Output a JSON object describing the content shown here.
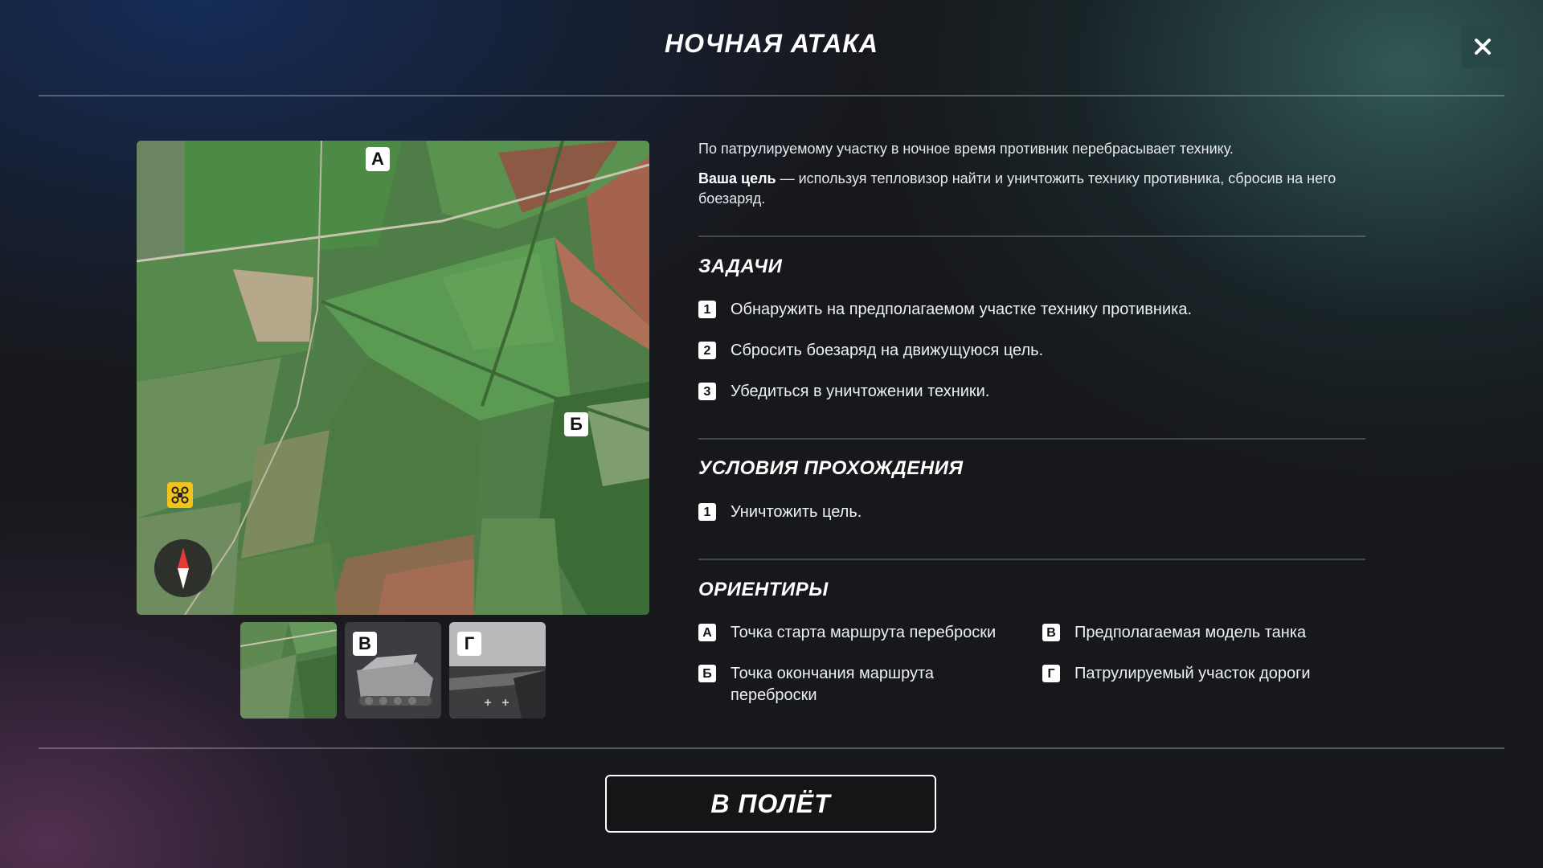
{
  "header": {
    "title": "НОЧНАЯ АТАКА",
    "close_icon": "close-icon"
  },
  "map": {
    "markers": {
      "a": "А",
      "b": "Б"
    },
    "drone_icon": "drone-icon",
    "compass_icon": "compass-icon"
  },
  "thumbnails": [
    {
      "label": "",
      "kind": "map"
    },
    {
      "label": "В",
      "kind": "tank"
    },
    {
      "label": "Г",
      "kind": "road"
    }
  ],
  "description": {
    "intro": "По патрулируемому участку в ночное время противник перебрасывает технику.",
    "goal_label": "Ваша цель",
    "goal_text": " — используя тепловизор найти и уничтожить технику противника, сбросив на него боезаряд."
  },
  "tasks": {
    "title": "ЗАДАЧИ",
    "items": [
      {
        "num": "1",
        "text": "Обнаружить на предполагаемом участке технику противника."
      },
      {
        "num": "2",
        "text": "Сбросить боезаряд на движущуюся цель."
      },
      {
        "num": "3",
        "text": "Убедиться в уничтожении техники."
      }
    ]
  },
  "conditions": {
    "title": "УСЛОВИЯ ПРОХОЖДЕНИЯ",
    "items": [
      {
        "num": "1",
        "text": "Уничтожить цель."
      }
    ]
  },
  "landmarks": {
    "title": "ОРИЕНТИРЫ",
    "items": [
      {
        "key": "А",
        "text": "Точка старта маршрута переброски"
      },
      {
        "key": "Б",
        "text": "Точка окончания маршрута переброски"
      },
      {
        "key": "В",
        "text": "Предполагаемая модель танка"
      },
      {
        "key": "Г",
        "text": "Патрулируемый участок дороги"
      }
    ]
  },
  "footer": {
    "start_button": "В ПОЛЁТ"
  },
  "colors": {
    "drone_marker": "#f3c21b",
    "compass_north": "#e53935",
    "accent_panel": "#2e5a58"
  }
}
